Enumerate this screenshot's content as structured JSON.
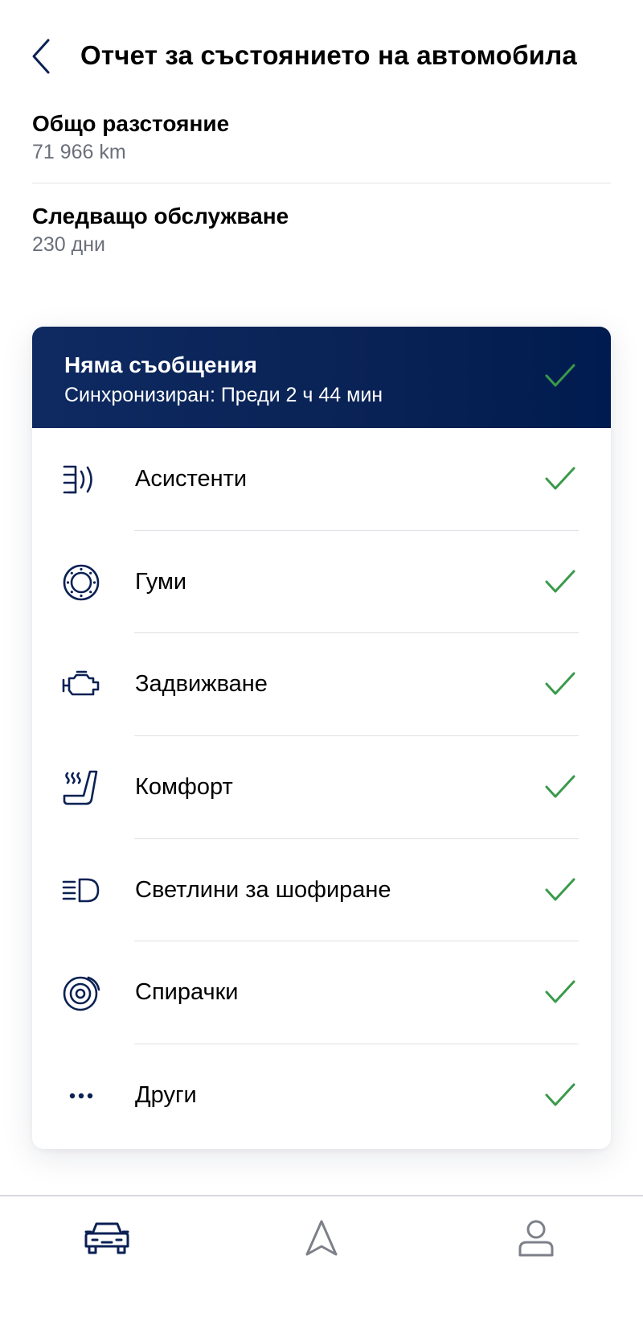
{
  "header": {
    "title": "Отчет за състоянието на автомобила"
  },
  "info": {
    "mileage_label": "Общо разстояние",
    "mileage_value": "71 966 km",
    "service_label": "Следващо обслужване",
    "service_value": "230 дни"
  },
  "status_card": {
    "title": "Няма съобщения",
    "subtitle": "Синхронизиран: Преди 2 ч 44 мин",
    "items": [
      {
        "label": "Асистенти",
        "icon": "driver-assist-icon",
        "status": "ok"
      },
      {
        "label": "Гуми",
        "icon": "tire-icon",
        "status": "ok"
      },
      {
        "label": "Задвижване",
        "icon": "engine-icon",
        "status": "ok"
      },
      {
        "label": "Комфорт",
        "icon": "heated-seat-icon",
        "status": "ok"
      },
      {
        "label": "Светлини за шофиране",
        "icon": "headlight-icon",
        "status": "ok"
      },
      {
        "label": "Спирачки",
        "icon": "brake-disc-icon",
        "status": "ok"
      },
      {
        "label": "Други",
        "icon": "more-icon",
        "status": "ok"
      }
    ]
  },
  "bottom_nav": {
    "tabs": [
      {
        "icon": "car-icon",
        "active": true
      },
      {
        "icon": "navigation-arrow-icon",
        "active": false
      },
      {
        "icon": "profile-icon",
        "active": false
      }
    ]
  },
  "colors": {
    "brand_navy": "#0a2356",
    "icon_navy": "#0b2154",
    "check_green": "#3a9a4b",
    "inactive_gray": "#7d8089",
    "secondary_text": "#6b6f7a"
  }
}
